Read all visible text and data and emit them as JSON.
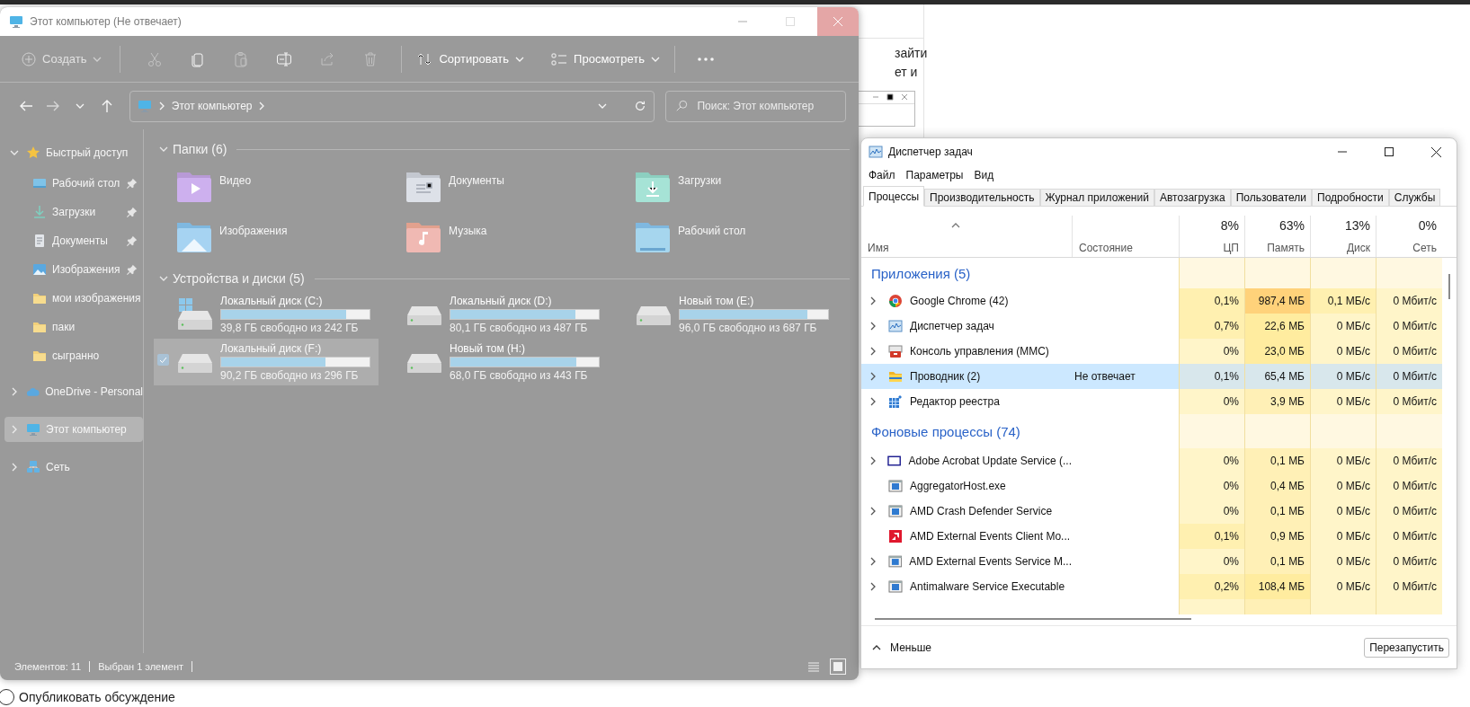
{
  "desktop": {
    "page_text": [
      "зайти",
      "ет и"
    ],
    "post": {
      "label": "Опубликовать обсуждение",
      "checked": false
    }
  },
  "explorer": {
    "title": "Этот компьютер (Не отвечает)",
    "toolbar": {
      "create": {
        "label": "Создать",
        "disabled": true
      },
      "icon_buttons": [
        {
          "kind": "cut",
          "disabled": true
        },
        {
          "kind": "copy",
          "disabled": false
        },
        {
          "kind": "paste",
          "disabled": true
        },
        {
          "kind": "rename",
          "disabled": false
        },
        {
          "kind": "share",
          "disabled": true
        },
        {
          "kind": "delete",
          "disabled": true
        }
      ],
      "sort": {
        "label": "Сортировать"
      },
      "view": {
        "label": "Просмотреть"
      }
    },
    "address": {
      "path": [
        "Этот компьютер"
      ],
      "search_placeholder": "Поиск: Этот компьютер"
    },
    "sidebar": {
      "items": [
        {
          "label": "Быстрый доступ",
          "kind": "star",
          "expanded": true,
          "selected": false,
          "children": [
            {
              "label": "Рабочий стол",
              "kind": "desktop",
              "pinned": true,
              "selected": false
            },
            {
              "label": "Загрузки",
              "kind": "download",
              "pinned": true,
              "selected": false
            },
            {
              "label": "Документы",
              "kind": "document",
              "pinned": true,
              "selected": false
            },
            {
              "label": "Изображения",
              "kind": "image",
              "pinned": true,
              "selected": false
            },
            {
              "label": "мои изображения",
              "kind": "folder",
              "pinned": false,
              "selected": false
            },
            {
              "label": "паки",
              "kind": "folder",
              "pinned": false,
              "selected": false
            },
            {
              "label": "сыгранно",
              "kind": "folder",
              "pinned": false,
              "selected": false
            }
          ]
        },
        {
          "label": "OneDrive - Personal",
          "kind": "cloud",
          "expanded": false,
          "selected": false
        },
        {
          "label": "Этот компьютер",
          "kind": "computer",
          "expanded": false,
          "selected": true
        },
        {
          "label": "Сеть",
          "kind": "network",
          "expanded": false,
          "selected": false
        }
      ]
    },
    "folders": {
      "title": "Папки (6)",
      "expanded": true,
      "items": [
        {
          "label": "Видео",
          "kind": "video"
        },
        {
          "label": "Документы",
          "kind": "documents"
        },
        {
          "label": "Загрузки",
          "kind": "downloads"
        },
        {
          "label": "Изображения",
          "kind": "images"
        },
        {
          "label": "Музыка",
          "kind": "music"
        },
        {
          "label": "Рабочий стол",
          "kind": "desktop"
        }
      ]
    },
    "drives": {
      "title": "Устройства и диски (5)",
      "expanded": true,
      "items": [
        {
          "name": "Локальный диск (C:)",
          "free": "39,8 ГБ свободно из 242 ГБ",
          "level": 0.84,
          "kind": "system",
          "selected": false
        },
        {
          "name": "Локальный диск (D:)",
          "free": "80,1 ГБ свободно из 487 ГБ",
          "level": 0.84,
          "kind": "drive",
          "selected": false
        },
        {
          "name": "Новый том (E:)",
          "free": "96,0 ГБ свободно из 687 ГБ",
          "level": 0.86,
          "kind": "drive",
          "selected": false
        },
        {
          "name": "Локальный диск (F:)",
          "free": "90,2 ГБ свободно из 296 ГБ",
          "level": 0.7,
          "kind": "drive",
          "selected": true
        },
        {
          "name": "Новый том (H:)",
          "free": "68,0 ГБ свободно из 443 ГБ",
          "level": 0.85,
          "kind": "drive",
          "selected": false
        }
      ]
    },
    "status_bar": [
      "Элементов: 11",
      "Выбран 1 элемент"
    ],
    "view_modes": [
      {
        "kind": "details",
        "selected": false
      },
      {
        "kind": "tiles",
        "selected": true
      }
    ]
  },
  "task_manager": {
    "title": "Диспетчер задач",
    "menu": [
      "Файл",
      "Параметры",
      "Вид"
    ],
    "tabs": [
      {
        "label": "Процессы",
        "selected": true
      },
      {
        "label": "Производительность",
        "selected": false
      },
      {
        "label": "Журнал приложений",
        "selected": false
      },
      {
        "label": "Автозагрузка",
        "selected": false
      },
      {
        "label": "Пользователи",
        "selected": false
      },
      {
        "label": "Подробности",
        "selected": false
      },
      {
        "label": "Службы",
        "selected": false
      }
    ],
    "columns": [
      {
        "label": "Имя",
        "sorted": true
      },
      {
        "label": "Состояние",
        "sorted": false
      },
      {
        "total": "8%",
        "label": "ЦП",
        "sorted": false
      },
      {
        "total": "63%",
        "label": "Память",
        "sorted": false
      },
      {
        "total": "13%",
        "label": "Диск",
        "sorted": false
      },
      {
        "total": "0%",
        "label": "Сеть",
        "sorted": false
      }
    ],
    "groups": [
      {
        "title": "Приложения (5)",
        "rows": [
          {
            "name": "Google Chrome (42)",
            "kind": "chrome",
            "expandable": true,
            "selected": false,
            "cpu": "0,1%",
            "memory": "987,4 МБ",
            "disk": "0,1 МБ/с",
            "network": "0 Мбит/с"
          },
          {
            "name": "Диспетчер задач",
            "kind": "taskmgr",
            "expandable": true,
            "selected": false,
            "cpu": "0,7%",
            "memory": "22,6 МБ",
            "disk": "0 МБ/с",
            "network": "0 Мбит/с"
          },
          {
            "name": "Консоль управления (MMC)",
            "kind": "mmc",
            "expandable": true,
            "selected": false,
            "cpu": "0%",
            "memory": "23,0 МБ",
            "disk": "0 МБ/с",
            "network": "0 Мбит/с"
          },
          {
            "name": "Проводник (2)",
            "kind": "explorer",
            "expandable": true,
            "selected": true,
            "status": "Не отвечает",
            "cpu": "0,1%",
            "memory": "65,4 МБ",
            "disk": "0 МБ/с",
            "network": "0 Мбит/с"
          },
          {
            "name": "Редактор реестра",
            "kind": "regedit",
            "expandable": true,
            "selected": false,
            "cpu": "0%",
            "memory": "3,9 МБ",
            "disk": "0 МБ/с",
            "network": "0 Мбит/с"
          }
        ]
      },
      {
        "title": "Фоновые процессы (74)",
        "rows": [
          {
            "name": "Adobe Acrobat Update Service (...",
            "kind": "acrobat",
            "expandable": true,
            "selected": false,
            "cpu": "0%",
            "memory": "0,1 МБ",
            "disk": "0 МБ/с",
            "network": "0 Мбит/с"
          },
          {
            "name": "AggregatorHost.exe",
            "kind": "service",
            "expandable": false,
            "selected": false,
            "cpu": "0%",
            "memory": "0,4 МБ",
            "disk": "0 МБ/с",
            "network": "0 Мбит/с"
          },
          {
            "name": "AMD Crash Defender Service",
            "kind": "service",
            "expandable": true,
            "selected": false,
            "cpu": "0%",
            "memory": "0,1 МБ",
            "disk": "0 МБ/с",
            "network": "0 Мбит/с"
          },
          {
            "name": "AMD External Events Client Mo...",
            "kind": "amd",
            "expandable": false,
            "selected": false,
            "cpu": "0,1%",
            "memory": "0,9 МБ",
            "disk": "0 МБ/с",
            "network": "0 Мбит/с"
          },
          {
            "name": "AMD External Events Service M...",
            "kind": "service",
            "expandable": true,
            "selected": false,
            "cpu": "0%",
            "memory": "0,1 МБ",
            "disk": "0 МБ/с",
            "network": "0 Мбит/с"
          },
          {
            "name": "Antimalware Service Executable",
            "kind": "service",
            "expandable": true,
            "selected": false,
            "cpu": "0,2%",
            "memory": "108,4 МБ",
            "disk": "0 МБ/с",
            "network": "0 Мбит/с"
          }
        ]
      }
    ],
    "footer": {
      "collapse_label": "Меньше",
      "restart_button": "Перезапустить"
    }
  }
}
